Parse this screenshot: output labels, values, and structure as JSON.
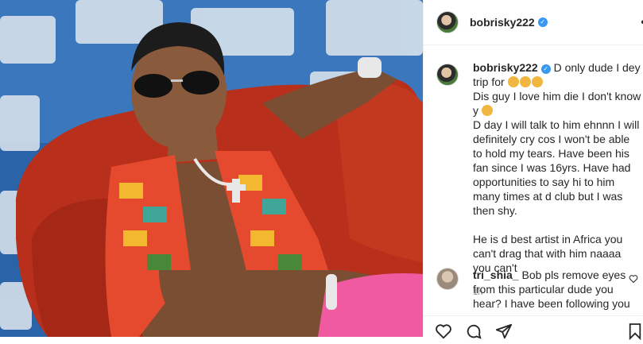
{
  "post": {
    "username": "bobrisky222",
    "more_icon": "•",
    "verified_mark": "✓"
  },
  "caption": {
    "username": "bobrisky222",
    "line1": " D only dude I dey trip for ",
    "line2": "\nDis guy I love him die I don't know y ",
    "body": "\nD day I will talk to him ehnnn I will definitely cry cos I won't be able to hold my tears. Have been his fan since I was 16yrs. Have had opportunities to say hi to him many times at d club but I was then shy.\n\nHe is d best artist in Africa you can't drag that with him naaaa you can't",
    "time": "1h"
  },
  "comment": {
    "username": "tri_shia_",
    "text": " Bob pls remove eyes from this particular dude you hear? I have been following you"
  },
  "icons": [
    "heart-icon",
    "comment-icon",
    "share-icon",
    "bookmark-icon",
    "verified-icon",
    "more-icon",
    "small-heart-icon"
  ],
  "colors": {
    "verified": "#3897f0",
    "text": "#262626",
    "muted": "#8e8e8e",
    "sofa": "#b8301c"
  }
}
